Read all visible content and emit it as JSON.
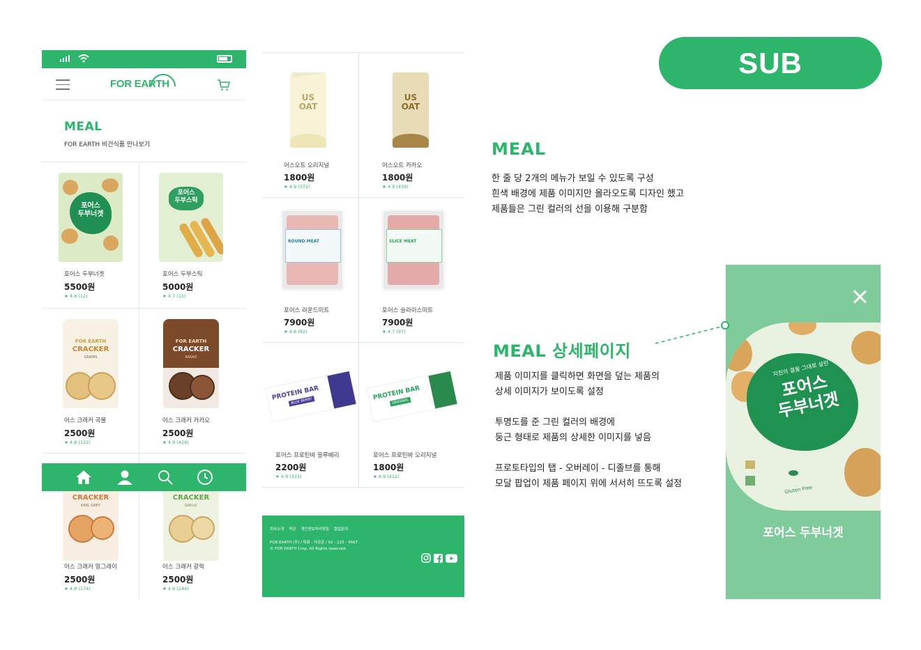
{
  "phone_meal": {
    "logo": "FOR EARTH",
    "section_title": "MEAL",
    "section_sub": "FOR EARTH 비건식품 만나보기",
    "products": [
      {
        "name": "포어스 두부너겟",
        "price": "5500원",
        "rating": "★ 4.8 (12)",
        "pack_line1": "포어스",
        "pack_line2": "두부너겟"
      },
      {
        "name": "포어스 두부스틱",
        "price": "5000원",
        "rating": "★ 4.7 (15)",
        "pack_line1": "포어스",
        "pack_line2": "두부스틱"
      },
      {
        "name": "어스 크래커 곡물",
        "price": "2500원",
        "rating": "★ 4.8 (122)",
        "pack_line1": "FOR EARTH",
        "pack_line2": "CRACKER",
        "pack_line3": "GRAINS"
      },
      {
        "name": "어스 크래커 카카오",
        "price": "2500원",
        "rating": "★ 4.9 (429)",
        "pack_line1": "FOR EARTH",
        "pack_line2": "CRACKER",
        "pack_line3": "KAKAO"
      },
      {
        "name": "어스 크래커 얼그레이",
        "price": "2500원",
        "rating": "★ 4.8 (174)",
        "pack_line2": "CRACKER",
        "pack_line3": "EARL GREY"
      },
      {
        "name": "어스 크래커 갈릭",
        "price": "2500원",
        "rating": "★ 4.9 (244)",
        "pack_line2": "CRACKER",
        "pack_line3": "GARLIC"
      }
    ]
  },
  "phone_list": {
    "products": [
      {
        "name": "어스오트 오리지널",
        "price": "1800원",
        "rating": "★ 4.9 (372)",
        "pack_line1": "US",
        "pack_line2": "OAT"
      },
      {
        "name": "어스오트 카카오",
        "price": "1800원",
        "rating": "★ 4.9 (439)",
        "pack_line1": "US",
        "pack_line2": "OAT"
      },
      {
        "name": "포어스 라운드미트",
        "price": "7900원",
        "rating": "★ 4.6 (82)",
        "pack_line1": "ROUND MEAT"
      },
      {
        "name": "포어스 슬라이스미트",
        "price": "7900원",
        "rating": "★ 4.7 (97)",
        "pack_line1": "SLICE MEAT"
      },
      {
        "name": "포어스 프로틴바 블루베리",
        "price": "2200원",
        "rating": "★ 4.9 (315)",
        "pack_line1": "PROTEIN BAR",
        "pack_line2": "BLUE BERRY"
      },
      {
        "name": "포어스 프로틴바 오리지널",
        "price": "1800원",
        "rating": "★ 4.9 (212)",
        "pack_line1": "PROTEIN BAR",
        "pack_line2": "ORIGINAL"
      }
    ],
    "footer": {
      "links": [
        "회사소개",
        "약관",
        "개인정보처리방침",
        "협업문의"
      ],
      "info": "FOR EARTH (주) / 대표 : 사공준 / 02 - 123 - 4567",
      "copyright": "© FOR EARTH Crop. All Rights reserved."
    }
  },
  "sub_label": "SUB",
  "meal_section": {
    "title": "MEAL",
    "lines": [
      "한 줄 당 2개의 메뉴가 보일 수 있도록 구성",
      "흰색 배경에 제품 이미지만 올라오도록 디자인 했고",
      "제품들은 그린 컬러의 선을 이용해 구분함"
    ]
  },
  "detail_section": {
    "title": "MEAL 상세페이지",
    "para1": [
      "제품 이미지를 클릭하면 화면을 덮는 제품의",
      "상세 이미지가 보이도록 설정"
    ],
    "para2": [
      "투명도를 준 그린 컬러의 배경에",
      "둥근 형태로 제품의 상세한 이미지를 넣음"
    ],
    "para3": [
      "프로토타입의 탭 - 오버레이 - 디졸브를 통해",
      "모달 팝업이 제품 페이지 위에 서서히 뜨도록 설정"
    ]
  },
  "modal": {
    "product_name": "포어스 두부너겟",
    "pack_tagline": "지친의 결을 그대로 살린",
    "pack_line1": "포어스",
    "pack_line2": "두부너겟",
    "badge_text": "Gluten Free"
  },
  "colors": {
    "brand_green": "#2db56b",
    "modal_bg": "#7fcb9b"
  }
}
